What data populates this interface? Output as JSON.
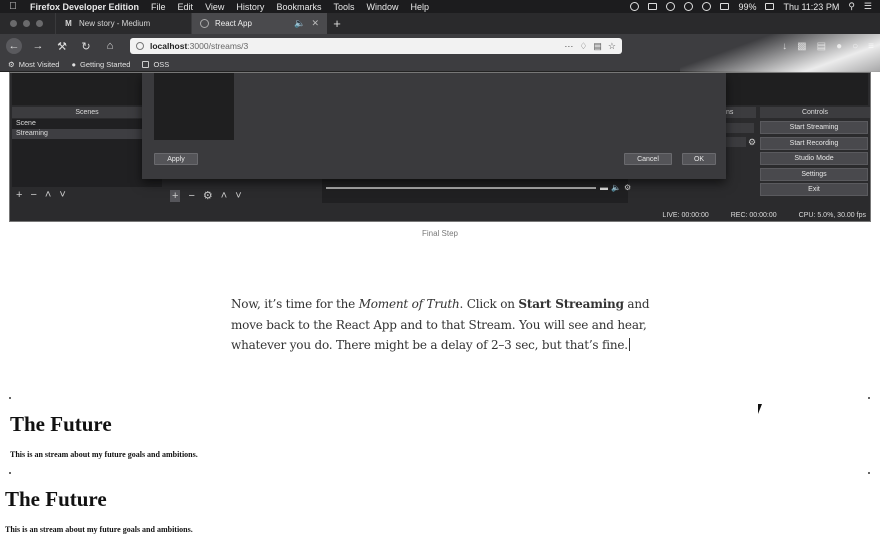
{
  "menubar": {
    "app_name": "Firefox Developer Edition",
    "items": [
      "File",
      "Edit",
      "View",
      "History",
      "Bookmarks",
      "Tools",
      "Window",
      "Help"
    ],
    "battery": "99%",
    "clock": "Thu 11:23 PM"
  },
  "tabs": [
    {
      "label": "New story - Medium",
      "favicon": "M",
      "active": false
    },
    {
      "label": "React App",
      "favicon": "react-icon",
      "active": true
    }
  ],
  "navbar": {
    "url_host": "localhost",
    "url_path": ":3000/streams/3"
  },
  "bookmarks": [
    "Most Visited",
    "Getting Started",
    "OSS"
  ],
  "obs": {
    "scenes_title": "Scenes",
    "scenes": [
      "Scene",
      "Streaming"
    ],
    "selected_scene": "Streaming",
    "controls_title": "Controls",
    "controls": [
      "Start Streaming",
      "Start Recording",
      "Studio Mode",
      "Settings",
      "Exit"
    ],
    "transitions_stub": "ns",
    "status": {
      "live": "LIVE: 00:00:00",
      "rec": "REC: 00:00:00",
      "cpu": "CPU: 5.0%, 30.00 fps"
    },
    "dialog": {
      "apply": "Apply",
      "cancel": "Cancel",
      "ok": "OK"
    }
  },
  "caption": "Final Step",
  "article": {
    "t1": "Now, it’s time for the ",
    "t2": "Moment of Truth",
    "t3": ". Click on ",
    "t4": "Start Streaming",
    "t5": " and move back to the React App and to that Stream. You will see and hear, whatever you do. There might be a delay of 2–3 sec, but that’s fine."
  },
  "streams": [
    {
      "title": "The Future",
      "description": "This is an stream about my future goals and ambitions."
    },
    {
      "title": "The Future",
      "description": "This is an stream about my future goals and ambitions."
    }
  ]
}
